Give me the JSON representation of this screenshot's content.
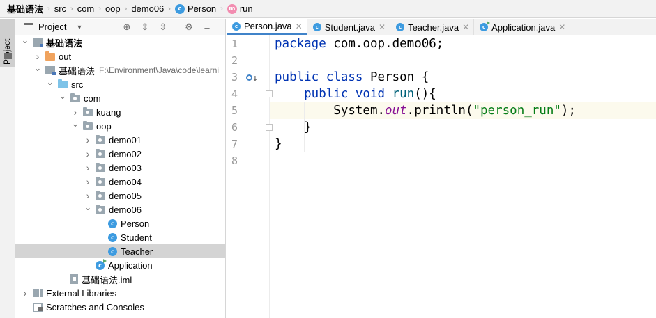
{
  "breadcrumb": {
    "items": [
      "基础语法",
      "src",
      "com",
      "oop",
      "demo06",
      "Person",
      "run"
    ]
  },
  "side": {
    "tab_label": "Project"
  },
  "project": {
    "title": "Project",
    "tree": [
      {
        "label": "基础语法",
        "indent": 0,
        "arrow": "down",
        "icon": "module",
        "bold": true
      },
      {
        "label": "out",
        "indent": 1,
        "arrow": "right",
        "icon": "folder-orange"
      },
      {
        "label": "基础语法",
        "path": "F:\\Environment\\Java\\code\\learni",
        "indent": 1,
        "arrow": "down",
        "icon": "module"
      },
      {
        "label": "src",
        "indent": 2,
        "arrow": "down",
        "icon": "folder-blue"
      },
      {
        "label": "com",
        "indent": 3,
        "arrow": "down",
        "icon": "package"
      },
      {
        "label": "kuang",
        "indent": 4,
        "arrow": "right",
        "icon": "package"
      },
      {
        "label": "oop",
        "indent": 4,
        "arrow": "down",
        "icon": "package"
      },
      {
        "label": "demo01",
        "indent": 5,
        "arrow": "right",
        "icon": "package"
      },
      {
        "label": "demo02",
        "indent": 5,
        "arrow": "right",
        "icon": "package"
      },
      {
        "label": "demo03",
        "indent": 5,
        "arrow": "right",
        "icon": "package"
      },
      {
        "label": "demo04",
        "indent": 5,
        "arrow": "right",
        "icon": "package"
      },
      {
        "label": "demo05",
        "indent": 5,
        "arrow": "right",
        "icon": "package"
      },
      {
        "label": "demo06",
        "indent": 5,
        "arrow": "down",
        "icon": "package"
      },
      {
        "label": "Person",
        "indent": 6,
        "arrow": "none",
        "icon": "class"
      },
      {
        "label": "Student",
        "indent": 6,
        "arrow": "none",
        "icon": "class"
      },
      {
        "label": "Teacher",
        "indent": 6,
        "arrow": "none",
        "icon": "class",
        "selected": true
      },
      {
        "label": "Application",
        "indent": 5,
        "arrow": "none",
        "icon": "class-run"
      },
      {
        "label": "基础语法.iml",
        "indent": 3,
        "arrow": "none",
        "icon": "iml"
      },
      {
        "label": "External Libraries",
        "indent": 0,
        "arrow": "right",
        "icon": "libraries"
      },
      {
        "label": "Scratches and Consoles",
        "indent": 0,
        "arrow": "none",
        "icon": "scratch"
      }
    ]
  },
  "tabs": [
    {
      "label": "Person.java",
      "active": true,
      "icon": "class"
    },
    {
      "label": "Student.java",
      "active": false,
      "icon": "class"
    },
    {
      "label": "Teacher.java",
      "active": false,
      "icon": "class"
    },
    {
      "label": "Application.java",
      "active": false,
      "icon": "class-run"
    }
  ],
  "editor": {
    "line_numbers": [
      "1",
      "2",
      "3",
      "4",
      "5",
      "6",
      "7",
      "8"
    ],
    "lines": [
      [
        {
          "t": "package",
          "c": "kw"
        },
        {
          "t": " com.oop.demo06;",
          "c": ""
        }
      ],
      [],
      [
        {
          "t": "public class",
          "c": "kw"
        },
        {
          "t": " Person {",
          "c": ""
        }
      ],
      [
        {
          "t": "    public void",
          "c": "kw"
        },
        {
          "t": " ",
          "c": ""
        },
        {
          "t": "run",
          "c": "fn"
        },
        {
          "t": "(){",
          "c": ""
        }
      ],
      [
        {
          "t": "        System.",
          "c": ""
        },
        {
          "t": "out",
          "c": "it"
        },
        {
          "t": ".println(",
          "c": ""
        },
        {
          "t": "\"person_run\"",
          "c": "str"
        },
        {
          "t": ");",
          "c": ""
        }
      ],
      [
        {
          "t": "    }",
          "c": ""
        }
      ],
      [
        {
          "t": "}",
          "c": ""
        }
      ],
      []
    ],
    "highlight_line": 5
  }
}
